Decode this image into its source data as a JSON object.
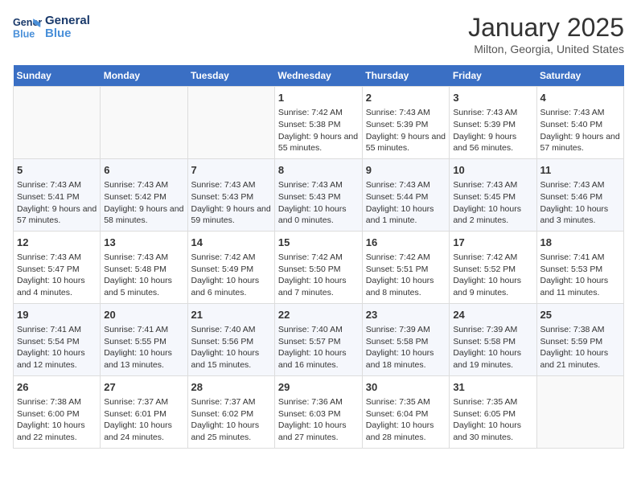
{
  "header": {
    "logo_line1": "General",
    "logo_line2": "Blue",
    "month": "January 2025",
    "location": "Milton, Georgia, United States"
  },
  "weekdays": [
    "Sunday",
    "Monday",
    "Tuesday",
    "Wednesday",
    "Thursday",
    "Friday",
    "Saturday"
  ],
  "weeks": [
    [
      {
        "day": "",
        "info": ""
      },
      {
        "day": "",
        "info": ""
      },
      {
        "day": "",
        "info": ""
      },
      {
        "day": "1",
        "info": "Sunrise: 7:42 AM\nSunset: 5:38 PM\nDaylight: 9 hours and 55 minutes."
      },
      {
        "day": "2",
        "info": "Sunrise: 7:43 AM\nSunset: 5:39 PM\nDaylight: 9 hours and 55 minutes."
      },
      {
        "day": "3",
        "info": "Sunrise: 7:43 AM\nSunset: 5:39 PM\nDaylight: 9 hours and 56 minutes."
      },
      {
        "day": "4",
        "info": "Sunrise: 7:43 AM\nSunset: 5:40 PM\nDaylight: 9 hours and 57 minutes."
      }
    ],
    [
      {
        "day": "5",
        "info": "Sunrise: 7:43 AM\nSunset: 5:41 PM\nDaylight: 9 hours and 57 minutes."
      },
      {
        "day": "6",
        "info": "Sunrise: 7:43 AM\nSunset: 5:42 PM\nDaylight: 9 hours and 58 minutes."
      },
      {
        "day": "7",
        "info": "Sunrise: 7:43 AM\nSunset: 5:43 PM\nDaylight: 9 hours and 59 minutes."
      },
      {
        "day": "8",
        "info": "Sunrise: 7:43 AM\nSunset: 5:43 PM\nDaylight: 10 hours and 0 minutes."
      },
      {
        "day": "9",
        "info": "Sunrise: 7:43 AM\nSunset: 5:44 PM\nDaylight: 10 hours and 1 minute."
      },
      {
        "day": "10",
        "info": "Sunrise: 7:43 AM\nSunset: 5:45 PM\nDaylight: 10 hours and 2 minutes."
      },
      {
        "day": "11",
        "info": "Sunrise: 7:43 AM\nSunset: 5:46 PM\nDaylight: 10 hours and 3 minutes."
      }
    ],
    [
      {
        "day": "12",
        "info": "Sunrise: 7:43 AM\nSunset: 5:47 PM\nDaylight: 10 hours and 4 minutes."
      },
      {
        "day": "13",
        "info": "Sunrise: 7:43 AM\nSunset: 5:48 PM\nDaylight: 10 hours and 5 minutes."
      },
      {
        "day": "14",
        "info": "Sunrise: 7:42 AM\nSunset: 5:49 PM\nDaylight: 10 hours and 6 minutes."
      },
      {
        "day": "15",
        "info": "Sunrise: 7:42 AM\nSunset: 5:50 PM\nDaylight: 10 hours and 7 minutes."
      },
      {
        "day": "16",
        "info": "Sunrise: 7:42 AM\nSunset: 5:51 PM\nDaylight: 10 hours and 8 minutes."
      },
      {
        "day": "17",
        "info": "Sunrise: 7:42 AM\nSunset: 5:52 PM\nDaylight: 10 hours and 9 minutes."
      },
      {
        "day": "18",
        "info": "Sunrise: 7:41 AM\nSunset: 5:53 PM\nDaylight: 10 hours and 11 minutes."
      }
    ],
    [
      {
        "day": "19",
        "info": "Sunrise: 7:41 AM\nSunset: 5:54 PM\nDaylight: 10 hours and 12 minutes."
      },
      {
        "day": "20",
        "info": "Sunrise: 7:41 AM\nSunset: 5:55 PM\nDaylight: 10 hours and 13 minutes."
      },
      {
        "day": "21",
        "info": "Sunrise: 7:40 AM\nSunset: 5:56 PM\nDaylight: 10 hours and 15 minutes."
      },
      {
        "day": "22",
        "info": "Sunrise: 7:40 AM\nSunset: 5:57 PM\nDaylight: 10 hours and 16 minutes."
      },
      {
        "day": "23",
        "info": "Sunrise: 7:39 AM\nSunset: 5:58 PM\nDaylight: 10 hours and 18 minutes."
      },
      {
        "day": "24",
        "info": "Sunrise: 7:39 AM\nSunset: 5:58 PM\nDaylight: 10 hours and 19 minutes."
      },
      {
        "day": "25",
        "info": "Sunrise: 7:38 AM\nSunset: 5:59 PM\nDaylight: 10 hours and 21 minutes."
      }
    ],
    [
      {
        "day": "26",
        "info": "Sunrise: 7:38 AM\nSunset: 6:00 PM\nDaylight: 10 hours and 22 minutes."
      },
      {
        "day": "27",
        "info": "Sunrise: 7:37 AM\nSunset: 6:01 PM\nDaylight: 10 hours and 24 minutes."
      },
      {
        "day": "28",
        "info": "Sunrise: 7:37 AM\nSunset: 6:02 PM\nDaylight: 10 hours and 25 minutes."
      },
      {
        "day": "29",
        "info": "Sunrise: 7:36 AM\nSunset: 6:03 PM\nDaylight: 10 hours and 27 minutes."
      },
      {
        "day": "30",
        "info": "Sunrise: 7:35 AM\nSunset: 6:04 PM\nDaylight: 10 hours and 28 minutes."
      },
      {
        "day": "31",
        "info": "Sunrise: 7:35 AM\nSunset: 6:05 PM\nDaylight: 10 hours and 30 minutes."
      },
      {
        "day": "",
        "info": ""
      }
    ]
  ]
}
